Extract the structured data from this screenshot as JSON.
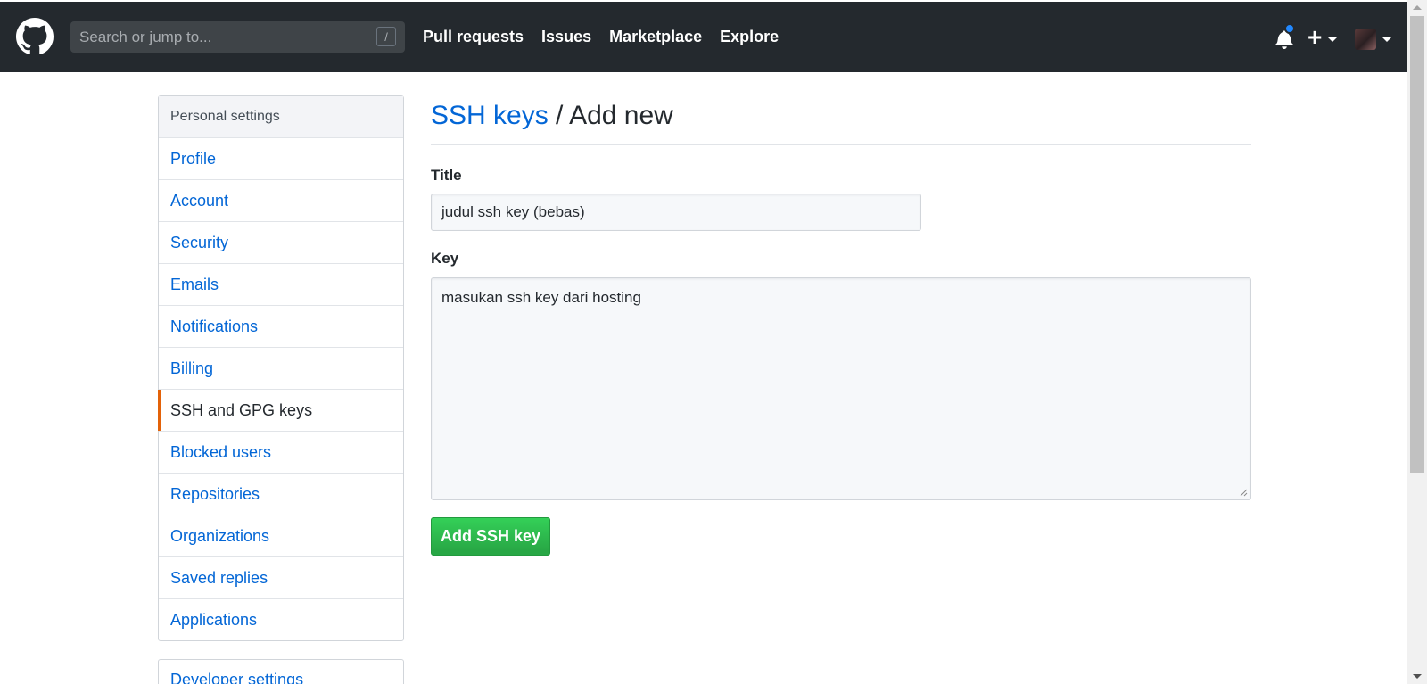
{
  "header": {
    "search_placeholder": "Search or jump to...",
    "search_shortcut": "/",
    "nav": [
      {
        "label": "Pull requests"
      },
      {
        "label": "Issues"
      },
      {
        "label": "Marketplace"
      },
      {
        "label": "Explore"
      }
    ],
    "new_label": "+"
  },
  "sidebar": {
    "header": "Personal settings",
    "items": [
      {
        "label": "Profile"
      },
      {
        "label": "Account"
      },
      {
        "label": "Security"
      },
      {
        "label": "Emails"
      },
      {
        "label": "Notifications"
      },
      {
        "label": "Billing"
      },
      {
        "label": "SSH and GPG keys"
      },
      {
        "label": "Blocked users"
      },
      {
        "label": "Repositories"
      },
      {
        "label": "Organizations"
      },
      {
        "label": "Saved replies"
      },
      {
        "label": "Applications"
      }
    ],
    "active_item": "SSH and GPG keys",
    "developer_settings": "Developer settings"
  },
  "main": {
    "breadcrumb_link": "SSH keys",
    "title_rest": " / Add new",
    "title_label": "Title",
    "title_value": "judul ssh key (bebas)",
    "key_label": "Key",
    "key_value": "masukan ssh key dari hosting",
    "submit_label": "Add SSH key"
  },
  "colors": {
    "header_bg": "#24292e",
    "link": "#0366d6",
    "active_marker": "#e36209",
    "button_green": "#28a745",
    "notification_dot": "#2188ff"
  }
}
